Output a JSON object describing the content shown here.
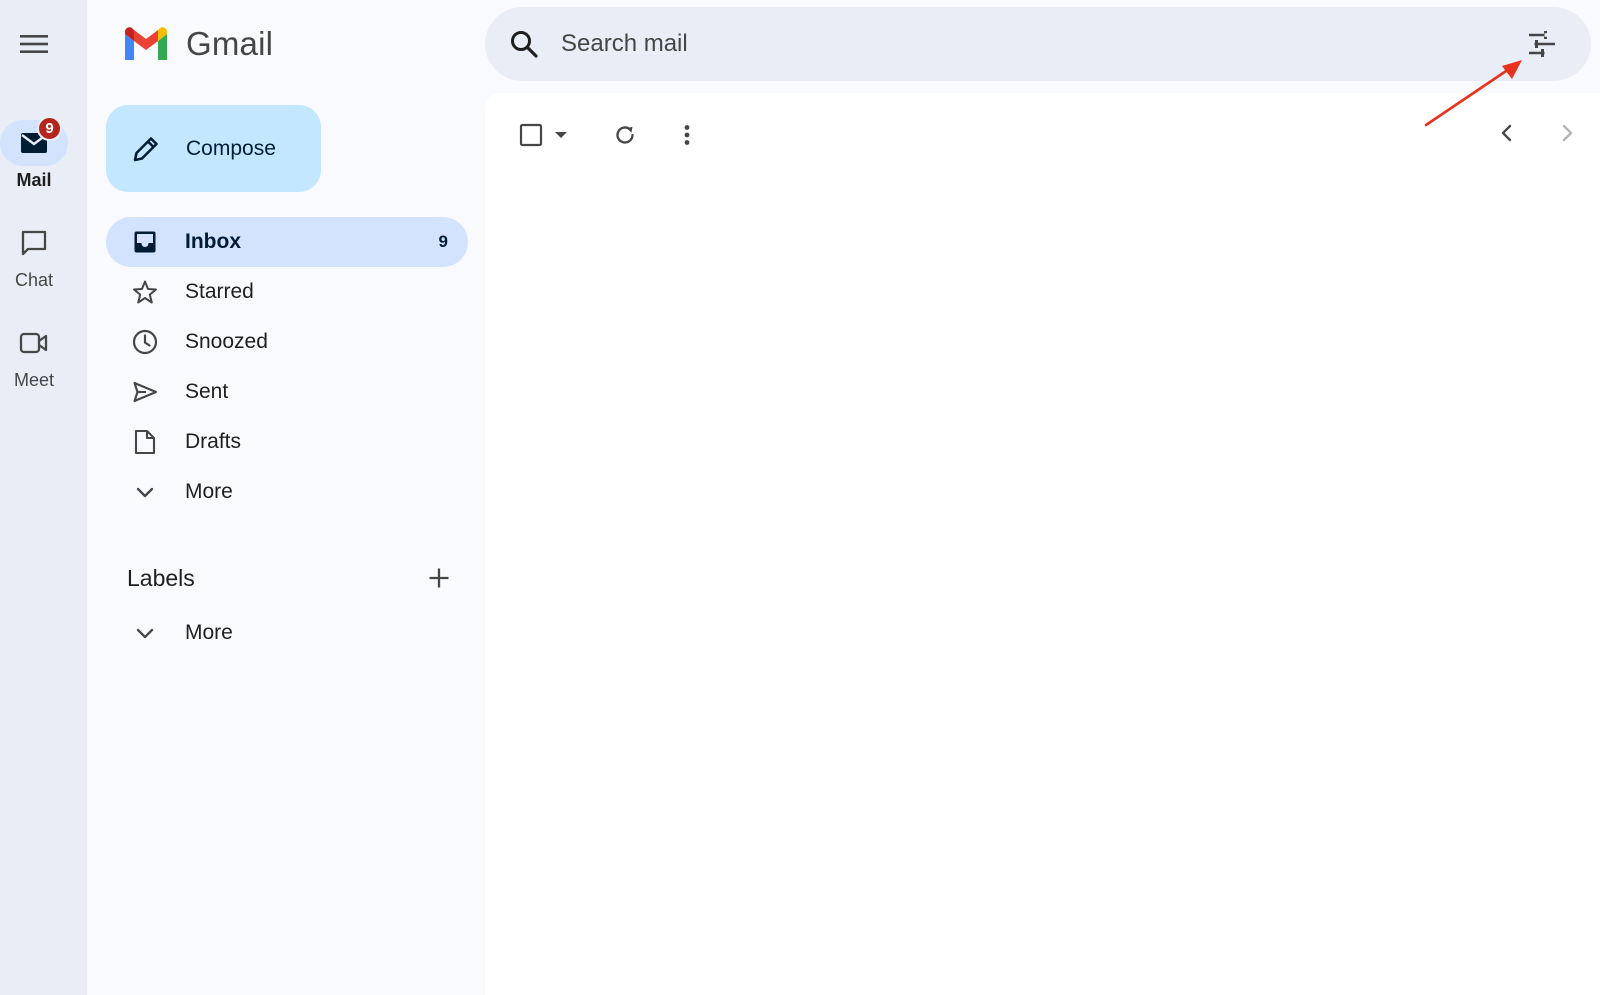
{
  "app": {
    "name": "Gmail"
  },
  "rail": {
    "items": [
      {
        "id": "mail",
        "label": "Mail",
        "badge": "9",
        "icon": "mail-icon"
      },
      {
        "id": "chat",
        "label": "Chat",
        "icon": "chat-icon"
      },
      {
        "id": "meet",
        "label": "Meet",
        "icon": "video-icon"
      }
    ]
  },
  "compose": {
    "label": "Compose"
  },
  "nav": {
    "items": [
      {
        "label": "Inbox",
        "count": "9",
        "icon": "inbox-icon"
      },
      {
        "label": "Starred",
        "icon": "star-icon"
      },
      {
        "label": "Snoozed",
        "icon": "clock-icon"
      },
      {
        "label": "Sent",
        "icon": "send-icon"
      },
      {
        "label": "Drafts",
        "icon": "draft-icon"
      },
      {
        "label": "More",
        "icon": "chevron-down-icon"
      }
    ]
  },
  "labels": {
    "title": "Labels",
    "more_label": "More"
  },
  "search": {
    "placeholder": "Search mail"
  },
  "colors": {
    "accent": "#c2e7ff",
    "active_nav": "#d3e3fd",
    "badge": "#b3261e",
    "annotation_arrow": "#e8321e"
  }
}
